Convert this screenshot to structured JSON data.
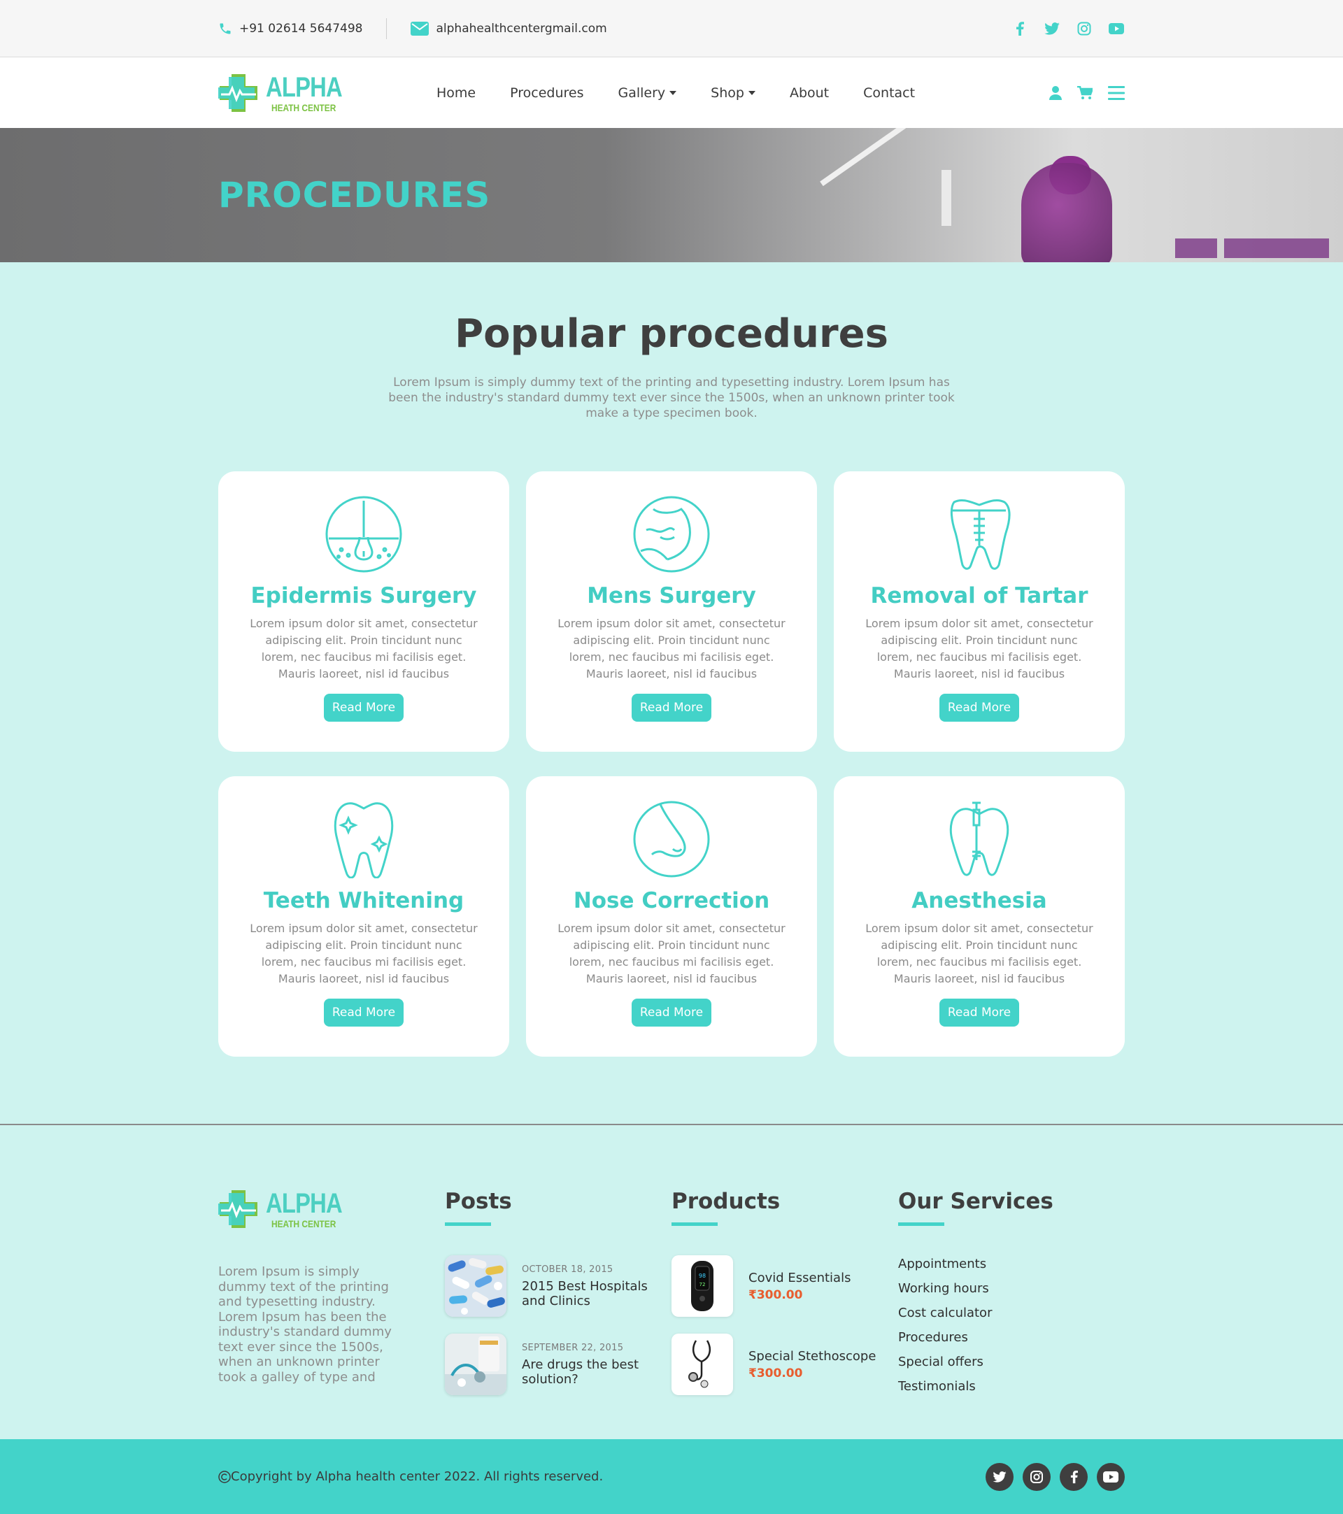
{
  "topbar": {
    "phone": "+91 02614 5647498",
    "email": "alphahealthcentergmail.com",
    "social_icons": [
      "facebook-icon",
      "twitter-icon",
      "instagram-icon",
      "youtube-icon"
    ]
  },
  "header": {
    "logo_title": "ALPHA",
    "logo_subtitle": "HEATH CENTER",
    "nav": [
      "Home",
      "Procedures",
      "Gallery",
      "Shop",
      "About",
      "Contact"
    ]
  },
  "banner": {
    "title": "PROCEDURES"
  },
  "main": {
    "heading": "Popular procedures",
    "intro": "Lorem Ipsum is simply dummy text of the printing and typesetting industry. Lorem Ipsum has been the industry's standard dummy text ever since the 1500s, when an unknown printer took make a type specimen book.",
    "cards": [
      {
        "title": "Epidermis Surgery",
        "icon": "skin-hair-follicle-icon",
        "text": "Lorem ipsum dolor sit amet, consectetur adipiscing elit. Proin tincidunt nunc lorem, nec faucibus mi facilisis eget. Mauris laoreet, nisl id faucibus pellentesque, mi...",
        "button": "Read More"
      },
      {
        "title": "Mens Surgery",
        "icon": "chest-muscle-icon",
        "text": "Lorem ipsum dolor sit amet, consectetur adipiscing elit. Proin tincidunt nunc lorem, nec faucibus mi facilisis eget. Mauris laoreet, nisl id faucibus pellentesque, mi...",
        "button": "Read More"
      },
      {
        "title": "Removal of Tartar",
        "icon": "tooth-implant-icon",
        "text": "Lorem ipsum dolor sit amet, consectetur adipiscing elit. Proin tincidunt nunc lorem, nec faucibus mi facilisis eget. Mauris laoreet, nisl id faucibus pellentesque, mi...",
        "button": "Read More"
      },
      {
        "title": "Teeth Whitening",
        "icon": "tooth-sparkle-icon",
        "text": "Lorem ipsum dolor sit amet, consectetur adipiscing elit. Proin tincidunt nunc lorem, nec faucibus mi facilisis eget. Mauris laoreet, nisl id faucibus pellentesque, mi...",
        "button": "Read More"
      },
      {
        "title": "Nose Correction",
        "icon": "nose-icon",
        "text": "Lorem ipsum dolor sit amet, consectetur adipiscing elit. Proin tincidunt nunc lorem, nec faucibus mi facilisis eget. Mauris laoreet, nisl id faucibus pellentesque, mi...",
        "button": "Read More"
      },
      {
        "title": "Anesthesia",
        "icon": "tooth-needle-icon",
        "text": "Lorem ipsum dolor sit amet, consectetur adipiscing elit. Proin tincidunt nunc lorem, nec faucibus mi facilisis eget. Mauris laoreet, nisl id faucibus pellentesque, mi...",
        "button": "Read More"
      }
    ]
  },
  "footer": {
    "logo_title": "ALPHA",
    "logo_subtitle": "HEATH CENTER",
    "about": "Lorem Ipsum is simply dummy text of the printing and typesetting industry. Lorem Ipsum has been the industry's standard dummy text ever since the 1500s, when an unknown printer took a galley of type and",
    "posts_heading": "Posts",
    "posts": [
      {
        "date": "OCTOBER 18, 2015",
        "title": "2015 Best Hospitals and Clinics"
      },
      {
        "date": "SEPTEMBER 22, 2015",
        "title": "Are drugs the best solution?"
      }
    ],
    "products_heading": "Products",
    "products": [
      {
        "name": "Covid Essentials",
        "price": "₹300.00"
      },
      {
        "name": "Special Stethoscope",
        "price": "₹300.00"
      }
    ],
    "services_heading": "Our Services",
    "services": [
      "Appointments",
      "Working hours",
      "Cost calculator",
      "Procedures",
      "Special offers",
      "Testimonials"
    ],
    "copyright": "Copyright by Alpha health center 2022. All rights reserved.",
    "social_icons": [
      "twitter-icon",
      "instagram-icon",
      "facebook-icon",
      "youtube-icon"
    ]
  },
  "colors": {
    "accent": "#43d3c9",
    "background": "#cef3ef",
    "price": "#e85d2f",
    "logo_green": "#7cc243"
  }
}
